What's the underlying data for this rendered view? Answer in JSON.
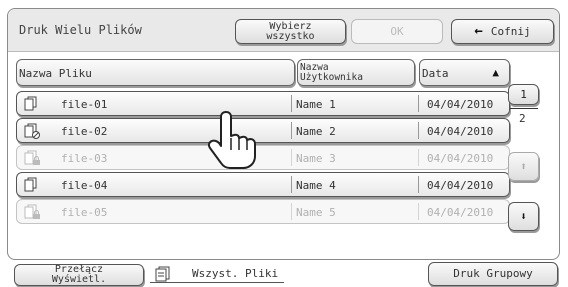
{
  "header": {
    "title": "Druk Wielu Plików",
    "select_all_line1": "Wybierz",
    "select_all_line2": "wszystko",
    "ok_label": "OK",
    "back_label": "Cofnij"
  },
  "columns": {
    "file_name": "Nazwa Pliku",
    "user_name_line1": "Nazwa",
    "user_name_line2": "Użytkownika",
    "date": "Data",
    "sort_indicator": "▲"
  },
  "files": [
    {
      "name": "file-01",
      "user": "Name 1",
      "date": "04/04/2010",
      "enabled": true,
      "icon": "document-icon"
    },
    {
      "name": "file-02",
      "user": "Name 2",
      "date": "04/04/2010",
      "enabled": true,
      "icon": "document-restricted-icon"
    },
    {
      "name": "file-03",
      "user": "Name 3",
      "date": "04/04/2010",
      "enabled": false,
      "icon": "document-locked-icon"
    },
    {
      "name": "file-04",
      "user": "Name 4",
      "date": "04/04/2010",
      "enabled": true,
      "icon": "document-icon"
    },
    {
      "name": "file-05",
      "user": "Name 5",
      "date": "04/04/2010",
      "enabled": false,
      "icon": "document-locked-icon"
    }
  ],
  "pagination": {
    "current_page": "1",
    "total_pages": "2"
  },
  "footer": {
    "switch_view_line1": "Przełącz",
    "switch_view_line2": "Wyświetl.",
    "all_files_label": "Wszyst. Pliki",
    "group_print_label": "Druk Grupowy"
  },
  "colors": {
    "enabled_text": "#333333",
    "disabled_text": "#b0b0b0",
    "title_bar_bg": "#e9e9e9"
  }
}
